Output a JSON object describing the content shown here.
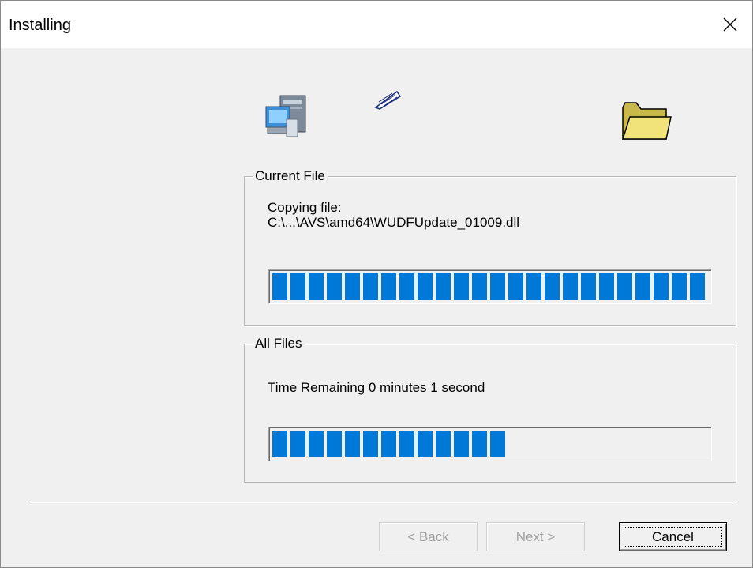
{
  "window": {
    "title": "Installing",
    "close_glyph": "✕"
  },
  "icons": {
    "computer": "computer-icon",
    "flying_paper": "flying-document-icon",
    "folder": "folder-icon"
  },
  "current_file": {
    "legend": "Current File",
    "line1": "Copying file:",
    "line2": "C:\\...\\AVS\\amd64\\WUDFUpdate_01009.dll",
    "progress": 1.0
  },
  "all_files": {
    "legend": "All Files",
    "status": "Time Remaining 0 minutes 1 second",
    "progress": 0.54
  },
  "buttons": {
    "back": "< Back",
    "next": "Next >",
    "cancel": "Cancel"
  },
  "colors": {
    "progress_fill": "#0078d7",
    "dialog_bg": "#f0f0f0",
    "folder": "#f2e27a"
  }
}
